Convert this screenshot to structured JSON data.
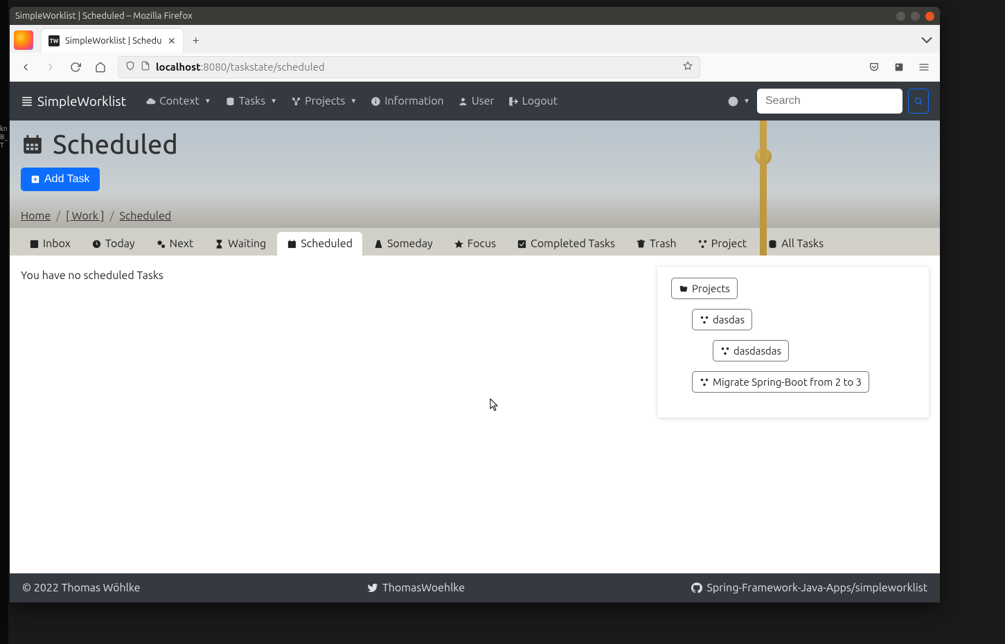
{
  "os": {
    "window_title": "SimpleWorklist | Scheduled – Mozilla Firefox"
  },
  "browser": {
    "tab_title": "SimpleWorklist | Schedule",
    "tab_favicon_text": "TW",
    "url_host": "localhost",
    "url_port_path": ":8080/taskstate/scheduled"
  },
  "navbar": {
    "brand": "SimpleWorklist",
    "context": "Context",
    "tasks": "Tasks",
    "projects": "Projects",
    "information": "Information",
    "user": "User",
    "logout": "Logout",
    "search_placeholder": "Search"
  },
  "page": {
    "title": "Scheduled",
    "add_task": "Add Task"
  },
  "breadcrumb": {
    "home": "Home",
    "context": "[ Work ]",
    "current": "Scheduled"
  },
  "tabs": {
    "inbox": "Inbox",
    "today": "Today",
    "next": "Next",
    "waiting": "Waiting",
    "scheduled": "Scheduled",
    "someday": "Someday",
    "focus": "Focus",
    "completed": "Completed Tasks",
    "trash": "Trash",
    "project": "Project",
    "all": "All Tasks"
  },
  "content": {
    "empty": "You have no scheduled Tasks"
  },
  "projects_panel": {
    "root": "Projects",
    "items": [
      {
        "label": "dasdas",
        "indent": 1
      },
      {
        "label": "dasdasdas",
        "indent": 2
      },
      {
        "label": "Migrate Spring-Boot from 2 to 3",
        "indent": 1
      }
    ]
  },
  "footer": {
    "copyright": "© 2022 Thomas Wöhlke",
    "twitter": "ThomasWoehlke",
    "github": "Spring-Framework-Java-Apps/simpleworklist"
  }
}
